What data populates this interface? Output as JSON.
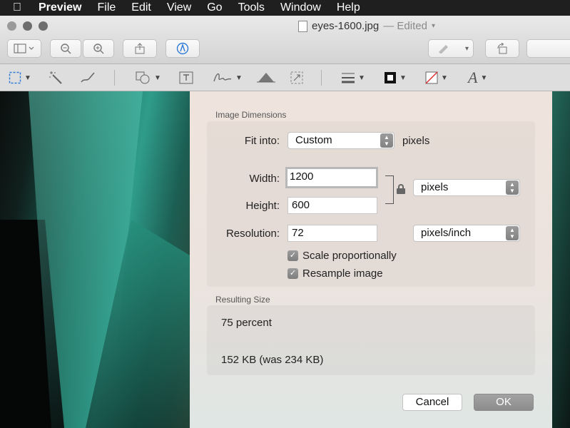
{
  "menubar": {
    "app": "Preview",
    "items": [
      "File",
      "Edit",
      "View",
      "Go",
      "Tools",
      "Window",
      "Help"
    ]
  },
  "window": {
    "filename": "eyes-1600.jpg",
    "status": "— Edited"
  },
  "toolbar": {
    "sidebar_icon": "sidebar-icon",
    "zoom_out_icon": "zoom-out-icon",
    "zoom_in_icon": "zoom-in-icon",
    "share_icon": "share-icon",
    "markup_icon": "markup-icon",
    "sign_icon": "pen-icon",
    "rotate_icon": "rotate-icon"
  },
  "dialog": {
    "group_title": "Image Dimensions",
    "fit_label": "Fit into:",
    "fit_value": "Custom",
    "fit_units": "pixels",
    "width_label": "Width:",
    "width_value": "1200",
    "height_label": "Height:",
    "height_value": "600",
    "dim_units": "pixels",
    "resolution_label": "Resolution:",
    "resolution_value": "72",
    "resolution_units": "pixels/inch",
    "scale_label": "Scale proportionally",
    "resample_label": "Resample image",
    "result_title": "Resulting Size",
    "result_percent": "75 percent",
    "result_size": "152 KB (was 234 KB)",
    "cancel_label": "Cancel",
    "ok_label": "OK"
  }
}
